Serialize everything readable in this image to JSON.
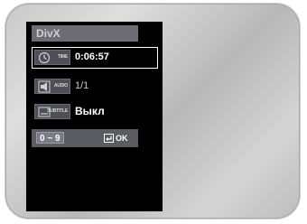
{
  "osd": {
    "title": "DivX",
    "rows": [
      {
        "icon": "time-icon",
        "label": "TIME",
        "value": "0:06:57",
        "selected": true
      },
      {
        "icon": "audio-icon",
        "label": "AUDIO",
        "value": "1/1",
        "selected": false
      },
      {
        "icon": "subtitle-icon",
        "label": "SUBTITLE",
        "value": "Выкл",
        "selected": false
      }
    ],
    "footer": {
      "digits_key": "0 ~ 9",
      "ok_label": "OK"
    }
  }
}
